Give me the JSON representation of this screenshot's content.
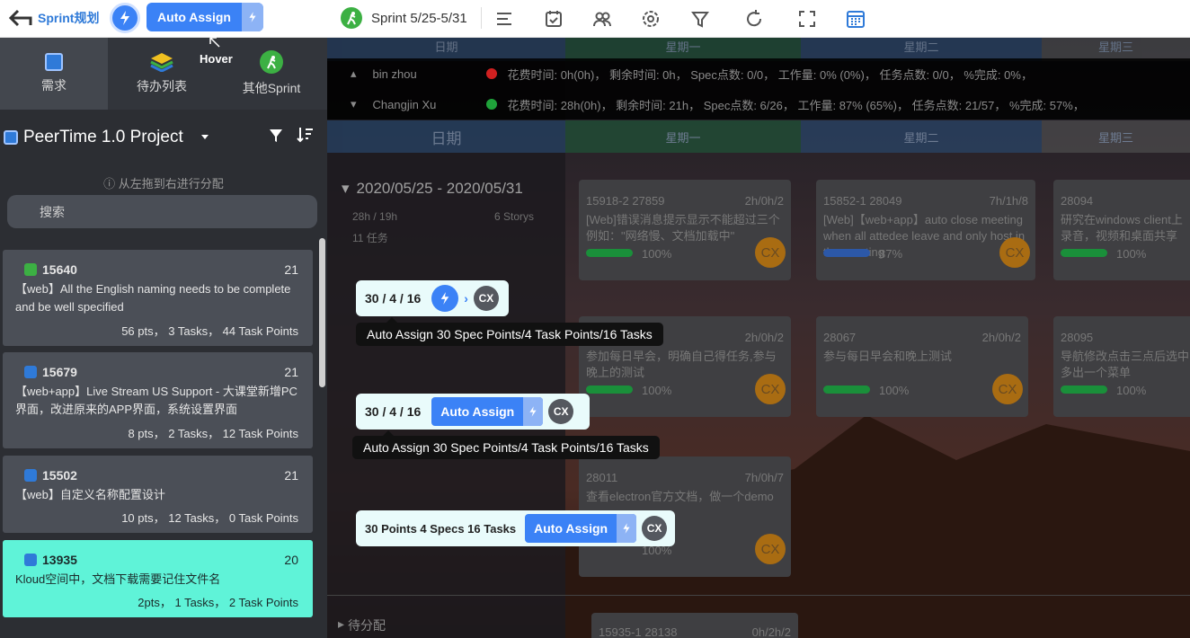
{
  "toolbar": {
    "back_label": "Sprint规划",
    "auto_assign_label": "Auto Assign",
    "sprint_label": "Sprint 5/25-5/31",
    "hover_label": "Hover"
  },
  "left": {
    "tabs": [
      {
        "label": "需求",
        "icon": "diamond-icon"
      },
      {
        "label": "待办列表",
        "icon": "stack-icon"
      },
      {
        "label": "其他Sprint",
        "icon": "runner-icon"
      }
    ],
    "project": "PeerTime 1.0 Project",
    "hint": "从左拖到右进行分配",
    "search_placeholder": "搜索",
    "cards": [
      {
        "id": "15640",
        "count": "21",
        "desc": "【web】All the English naming needs to be complete and be well specified",
        "stats": "56 pts，  3 Tasks，  44 Task Points"
      },
      {
        "id": "15679",
        "count": "21",
        "desc": "【web+app】Live Stream US Support - 大课堂新增PC界面，改进原来的APP界面，系统设置界面",
        "stats": "8 pts，  2 Tasks，  12 Task Points"
      },
      {
        "id": "15502",
        "count": "21",
        "desc": "【web】自定义名称配置设计",
        "stats": "10 pts，  12 Tasks，  0 Task Points"
      },
      {
        "id": "13935",
        "count": "20",
        "desc": "Kloud空间中，文档下载需要记住文件名",
        "stats": "2pts，  1 Tasks，    2 Task Points"
      }
    ]
  },
  "board": {
    "header_top": [
      "日期",
      "星期一",
      "星期二",
      "星期三"
    ],
    "header": [
      "日期",
      "星期一",
      "星期二",
      "星期三"
    ],
    "users": [
      {
        "name": "bin zhou",
        "status": "red",
        "stats": "花费时间: 0h(0h)，  剩余时间: 0h，  Spec点数: 0/0，  工作量: 0% (0%)，  任务点数: 0/0，  %完成: 0%，"
      },
      {
        "name": "Changjin Xu",
        "status": "green",
        "stats": "花费时间: 28h(0h)，  剩余时间: 21h，  Spec点数: 6/26，  工作量: 87% (65%)，  任务点数: 21/57，  %完成: 57%，"
      }
    ],
    "date_range": "2020/05/25 - 2020/05/31",
    "hours": "28h / 19h",
    "stories": "6 Storys",
    "tasks_count": "11  任务",
    "unassigned": "待分配",
    "tasks": [
      {
        "ids": "15918-2  27859",
        "time": "2h/0h/2",
        "title": "[Web]错误消息提示显示不能超过三个例如：\"网络慢、文档加载中\"",
        "pct": "100%",
        "av": "CX"
      },
      {
        "ids": "15852-1  28049",
        "time": "7h/1h/8",
        "title": "[Web]【web+app】auto close meeting when all attedee leave and only host in the meeting",
        "pct": "87%",
        "av": "CX"
      },
      {
        "ids": "28094",
        "time": "",
        "title": "研究在windows client上录音，视频和桌面共享",
        "pct": "100%",
        "av": ""
      },
      {
        "ids": "",
        "time": "2h/0h/2",
        "title": "参加每日早会，明确自己得任务,参与晚上的测试",
        "pct": "100%",
        "av": "CX"
      },
      {
        "ids": "28067",
        "time": "2h/0h/2",
        "title": "参与每日早会和晚上测试",
        "pct": "100%",
        "av": "CX"
      },
      {
        "ids": "28095",
        "time": "",
        "title": "导航修改点击三点后选中多出一个菜单",
        "pct": "100%",
        "av": ""
      },
      {
        "ids": "28011",
        "time": "7h/0h/7",
        "title": "查看electron官方文档，做一个demo",
        "pct": "100%",
        "av": "CX"
      },
      {
        "ids": "15935-1  28138",
        "time": "0h/2h/2",
        "title": "",
        "pct": "",
        "av": ""
      }
    ]
  },
  "widgets": [
    {
      "value": "30 / 4 / 16",
      "tooltip": "Auto Assign 30 Spec Points/4 Task Points/16 Tasks",
      "avatar": "CX"
    },
    {
      "value": "30 / 4 / 16",
      "button": "Auto Assign",
      "tooltip": "Auto Assign 30 Spec Points/4 Task Points/16 Tasks",
      "avatar": "CX"
    },
    {
      "value": "30 Points  4 Specs  16 Tasks",
      "button": "Auto Assign",
      "avatar": "CX"
    }
  ]
}
